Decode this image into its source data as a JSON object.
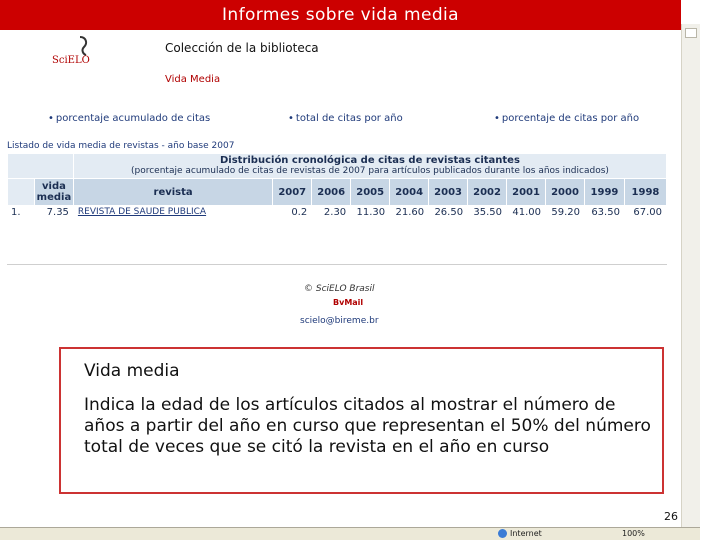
{
  "slide": {
    "title": "Informes sobre vida media",
    "page_number": "26"
  },
  "page": {
    "logo_text": "SciELO",
    "heading": "Colección de la biblioteca",
    "subheading": "Vida Media",
    "nav_links": [
      "porcentaje acumulado de citas",
      "total de citas por año",
      "porcentaje de citas por año"
    ],
    "table_caption": "Listado de vida media de revistas - año base 2007",
    "table": {
      "group_title": "Distribución cronológica de citas de revistas citantes",
      "group_subtitle": "(porcentaje acumulado de citas de revistas de 2007 para artículos publicados durante los años indicados)",
      "col_vida_media": "vida media",
      "col_revista": "revista",
      "years": [
        "2007",
        "2006",
        "2005",
        "2004",
        "2003",
        "2002",
        "2001",
        "2000",
        "1999",
        "1998"
      ],
      "rows": [
        {
          "index": "1.",
          "vida_media": "7.35",
          "revista": "REVISTA DE SAUDE PUBLICA",
          "values": [
            "0.2",
            "2.30",
            "11.30",
            "21.60",
            "26.50",
            "35.50",
            "41.00",
            "59.20",
            "63.50",
            "67.00"
          ]
        }
      ]
    },
    "footer": {
      "copyright": "© SciELO Brasil",
      "mark": "BvMail",
      "email": "scielo@bireme.br"
    }
  },
  "definition": {
    "title": "Vida media",
    "text": "Indica la edad de los artículos citados al mostrar el número de años a partir del año en curso que representan el 50% del número total de veces que se citó la revista en el año en curso"
  },
  "statusbar": {
    "zone": "Internet",
    "zoom": "100%"
  },
  "colors": {
    "title_bar": "#cc0000",
    "definition_border": "#cc3333",
    "table_header": "#c7d6e5",
    "link": "#1f3a7a"
  }
}
